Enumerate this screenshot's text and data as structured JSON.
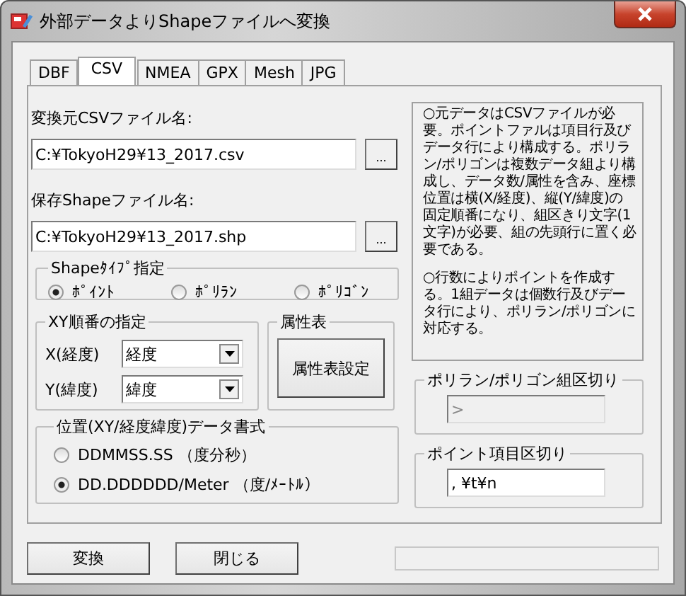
{
  "window": {
    "title": "外部データよりShapeファイルへ変換"
  },
  "tabs": [
    {
      "label": "DBF",
      "selected": false
    },
    {
      "label": "CSV",
      "selected": true
    },
    {
      "label": "NMEA",
      "selected": false
    },
    {
      "label": "GPX",
      "selected": false
    },
    {
      "label": "Mesh",
      "selected": false
    },
    {
      "label": "JPG",
      "selected": false
    }
  ],
  "source": {
    "label": "変換元CSVファイル名:",
    "value": "C:¥TokyoH29¥13_2017.csv",
    "browse": "..."
  },
  "save": {
    "label": "保存Shapeファイル名:",
    "value": "C:¥TokyoH29¥13_2017.shp",
    "browse": "..."
  },
  "shape_type": {
    "title": "Shapeﾀｲﾌﾟ指定",
    "options": [
      {
        "label": "ﾎﾟｲﾝﾄ",
        "selected": true
      },
      {
        "label": "ﾎﾟﾘﾗﾝ",
        "selected": false
      },
      {
        "label": "ﾎﾟﾘｺﾞﾝ",
        "selected": false
      }
    ]
  },
  "xy_order": {
    "title": "XY順番の指定",
    "fields": [
      {
        "label": "X(経度)",
        "value": "経度"
      },
      {
        "label": "Y(緯度)",
        "value": "緯度"
      }
    ]
  },
  "attributes": {
    "title": "属性表",
    "button": "属性表設定"
  },
  "format": {
    "title": "位置(XY/経度緯度)データ書式",
    "options": [
      {
        "label": "DDMMSS.SS （度分秒）",
        "selected": false
      },
      {
        "label": "DD.DDDDDD/Meter （度/ﾒｰﾄﾙ）",
        "selected": true
      }
    ]
  },
  "notes": [
    "○元データはCSVファイルが必要。ポイントファルは項目行及びデータ行により構成する。ポリラン/ポリゴンは複数データ組より構成し、データ数/属性を含み、座標位置は横(X/経度)、縦(Y/緯度)の固定順番になり、組区きり文字(1文字)が必要、組の先頭行に置く必要である。",
    "○行数によりポイントを作成する。1組データは個数行及びデータ行により、ポリラン/ポリゴンに対応する。"
  ],
  "polygon_separator": {
    "title": "ポリラン/ポリゴン組区切り",
    "value": ">",
    "disabled": true
  },
  "point_separator": {
    "title": "ポイント項目区切り",
    "value": ", ¥t¥n",
    "disabled": false
  },
  "buttons": [
    "変換",
    "閉じる"
  ],
  "progress": {
    "level": 0
  }
}
